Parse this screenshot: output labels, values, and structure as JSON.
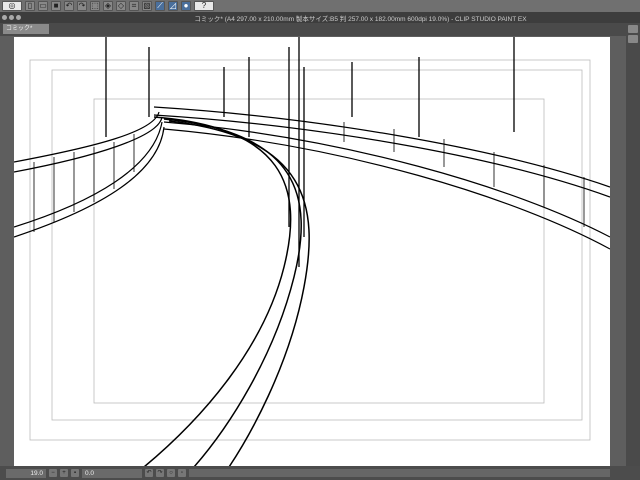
{
  "toolbar": {
    "buttons": [
      "logo",
      "new",
      "open",
      "save",
      "undo",
      "redo",
      "transform",
      "fill",
      "clear",
      "cut",
      "snap-ruler",
      "snap-grid",
      "snap-special",
      "help"
    ]
  },
  "window": {
    "title": "コミック* (A4 297.00 x 210.00mm 製本サイズ:B5 判 257.00 x 182.00mm 600dpi 19.0%)  - CLIP STUDIO PAINT EX"
  },
  "tab": {
    "label": "コミック*"
  },
  "status": {
    "zoom": "19.0",
    "rotation": "0.0"
  }
}
